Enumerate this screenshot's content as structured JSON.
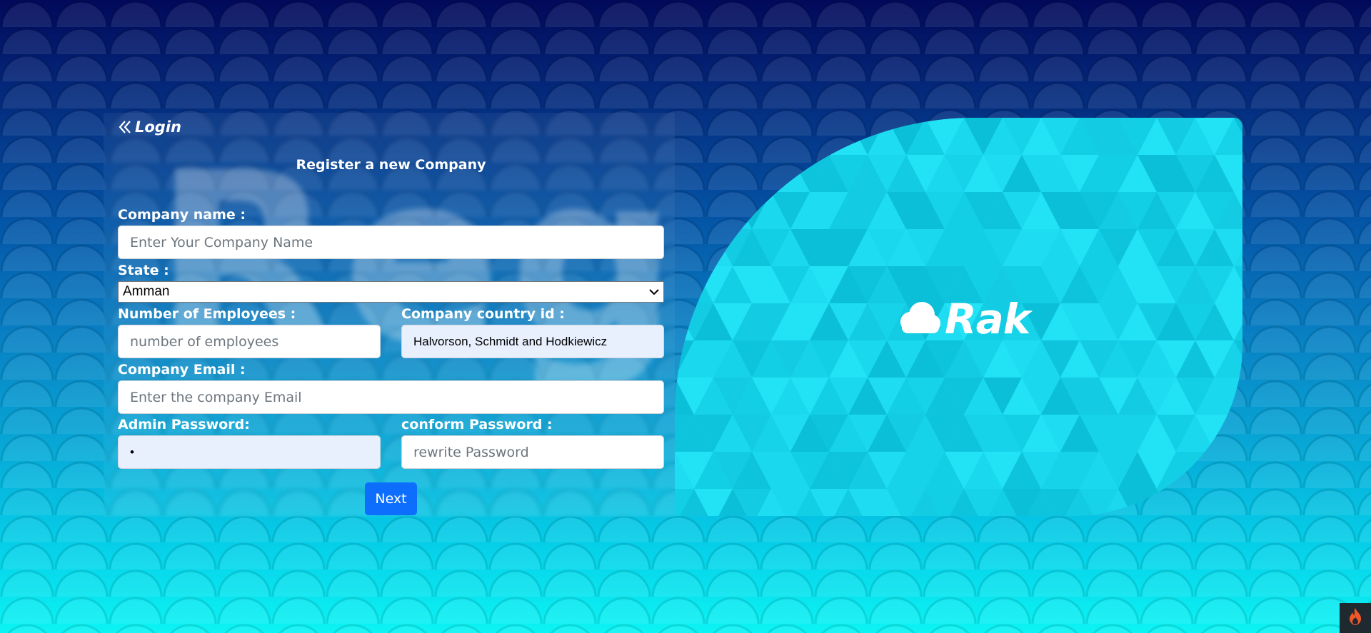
{
  "nav": {
    "login_label": "Login"
  },
  "form": {
    "title": "Register a new Company",
    "watermark_text": "Regi",
    "company_name": {
      "label": "Company name :",
      "placeholder": "Enter Your Company Name",
      "value": ""
    },
    "state": {
      "label": "State :",
      "selected": "Amman"
    },
    "employees": {
      "label": "Number of Employees :",
      "placeholder": "number of employees",
      "value": ""
    },
    "country_id": {
      "label": "Company country id :",
      "value": "Halvorson, Schmidt and Hodkiewicz"
    },
    "email": {
      "label": "Company Email :",
      "placeholder": "Enter the company Email",
      "value": ""
    },
    "admin_password": {
      "label": "Admin Password:",
      "value": "•"
    },
    "confirm_password": {
      "label": "conform Password :",
      "placeholder": "rewrite Password",
      "value": ""
    },
    "next_label": "Next"
  },
  "brand": {
    "name": "Rak",
    "icon": "cloud-icon"
  },
  "corner_widget": {
    "icon": "fire-icon"
  },
  "colors": {
    "button_primary": "#0d6efd",
    "card_cyan": "#18d8ee",
    "autofill_bg": "#e8f0fe",
    "bg_top": "#02095a",
    "bg_bottom": "#0cf4f4"
  }
}
